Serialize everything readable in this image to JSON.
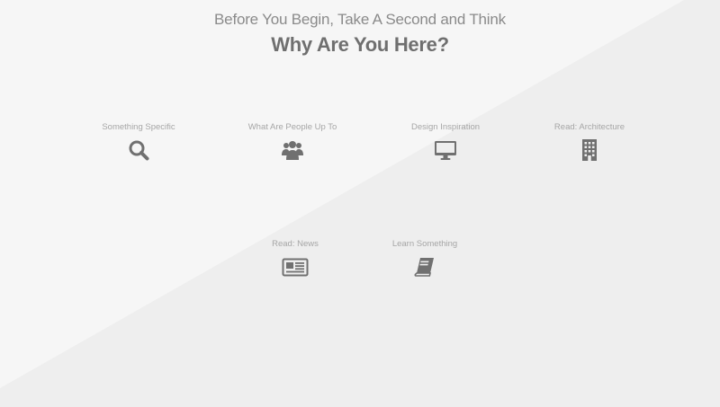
{
  "header": {
    "subtitle": "Before You Begin, Take A Second and Think",
    "title": "Why Are You Here?"
  },
  "choices": [
    {
      "label": "Something Specific",
      "icon": "search-icon"
    },
    {
      "label": "What Are People Up To",
      "icon": "users-icon"
    },
    {
      "label": "Design Inspiration",
      "icon": "desktop-icon"
    },
    {
      "label": "Read: Architecture",
      "icon": "building-icon"
    },
    {
      "label": "Read: News",
      "icon": "newspaper-icon"
    },
    {
      "label": "Learn Something",
      "icon": "book-icon"
    }
  ],
  "colors": {
    "background_light": "#f5f5f5",
    "background_dark": "#eeeeee",
    "icon": "#707070",
    "label": "#a6a6a6",
    "title": "#6f6f6f"
  }
}
